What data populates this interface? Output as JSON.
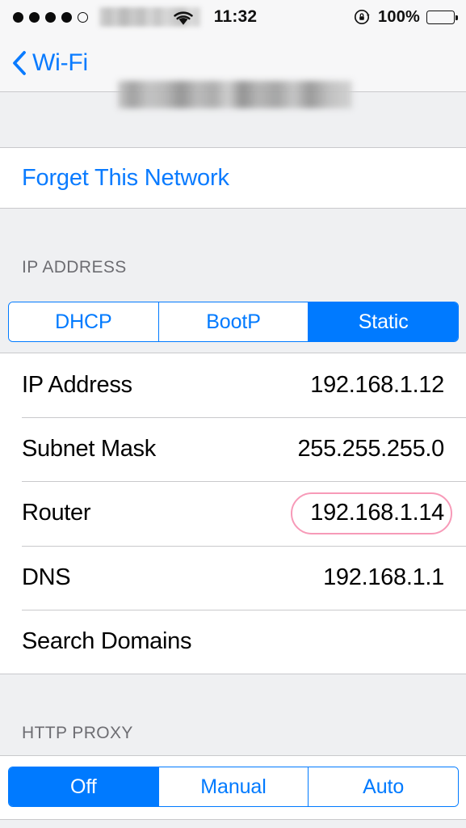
{
  "status_bar": {
    "signal_dots_filled": 4,
    "signal_dots_total": 5,
    "carrier": "",
    "wifi_icon": "wifi-icon",
    "time": "11:32",
    "rotation_lock_icon": "rotation-lock-icon",
    "battery_percent": "100%",
    "battery_level": 100
  },
  "nav": {
    "back_label": "Wi-Fi",
    "back_icon": "chevron-left-icon",
    "title": ""
  },
  "forget": {
    "label": "Forget This Network"
  },
  "ip_section": {
    "header": "IP ADDRESS",
    "modes": [
      {
        "label": "DHCP",
        "selected": false
      },
      {
        "label": "BootP",
        "selected": false
      },
      {
        "label": "Static",
        "selected": true
      }
    ],
    "rows": [
      {
        "label": "IP Address",
        "value": "192.168.1.12",
        "highlighted": false
      },
      {
        "label": "Subnet Mask",
        "value": "255.255.255.0",
        "highlighted": false
      },
      {
        "label": "Router",
        "value": "192.168.1.14",
        "highlighted": true
      },
      {
        "label": "DNS",
        "value": "192.168.1.1",
        "highlighted": false
      },
      {
        "label": "Search Domains",
        "value": "",
        "highlighted": false
      }
    ]
  },
  "proxy_section": {
    "header": "HTTP PROXY",
    "modes": [
      {
        "label": "Off",
        "selected": true
      },
      {
        "label": "Manual",
        "selected": false
      },
      {
        "label": "Auto",
        "selected": false
      }
    ]
  },
  "colors": {
    "accent_blue": "#007aff",
    "link_blue": "#0a7bff",
    "annotation_pink": "#f79ab8",
    "group_background": "#eff0f2",
    "separator": "#c9c9cc",
    "header_text": "#6d6d72"
  }
}
